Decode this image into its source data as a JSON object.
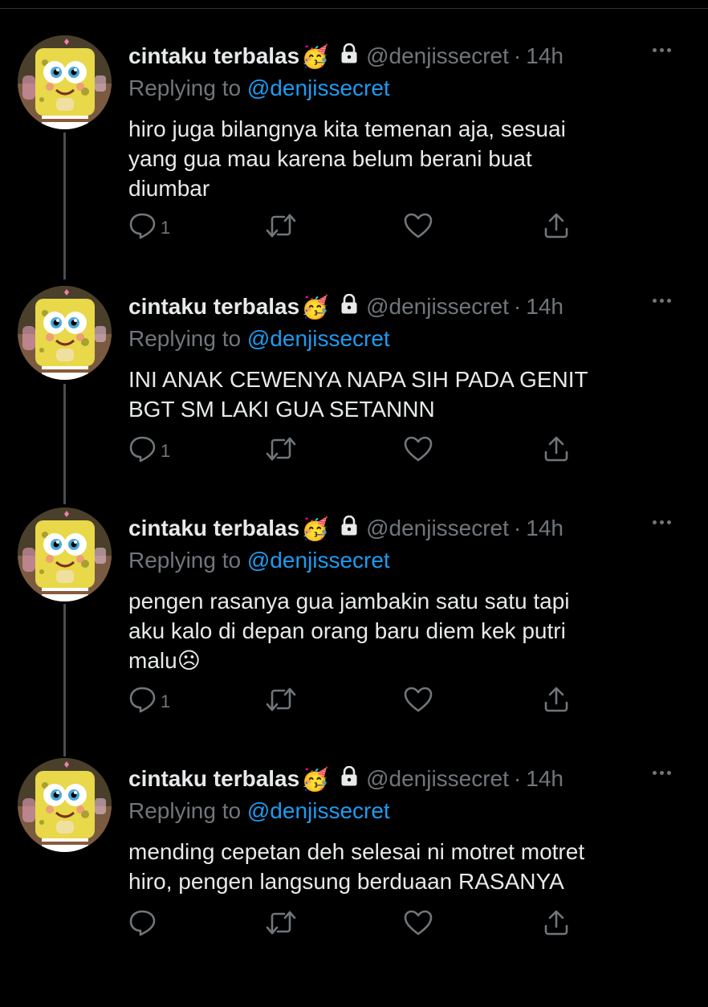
{
  "colors": {
    "background": "#000000",
    "text": "#e7e9ea",
    "muted": "#71767b",
    "link": "#1d9bf0"
  },
  "tweets": [
    {
      "name": "cintaku terbalas",
      "emoji": "🥳",
      "handle": "@denjissecret",
      "sep": "·",
      "time": "14h",
      "reply_prefix": "Replying to",
      "reply_to": "@denjissecret",
      "text": "hiro juga bilangnya kita temenan aja, sesuai\nyang gua mau karena belum berani buat\ndiumbar",
      "reply_count": "1"
    },
    {
      "name": "cintaku terbalas",
      "emoji": "🥳",
      "handle": "@denjissecret",
      "sep": "·",
      "time": "14h",
      "reply_prefix": "Replying to",
      "reply_to": "@denjissecret",
      "text": "INI ANAK CEWENYA NAPA SIH PADA GENIT\nBGT SM LAKI GUA SETANNN",
      "reply_count": "1"
    },
    {
      "name": "cintaku terbalas",
      "emoji": "🥳",
      "handle": "@denjissecret",
      "sep": "·",
      "time": "14h",
      "reply_prefix": "Replying to",
      "reply_to": "@denjissecret",
      "text": "pengen rasanya gua jambakin satu satu tapi\naku kalo di depan orang baru diem kek putri\nmalu☹",
      "reply_count": "1"
    },
    {
      "name": "cintaku terbalas",
      "emoji": "🥳",
      "handle": "@denjissecret",
      "sep": "·",
      "time": "14h",
      "reply_prefix": "Replying to",
      "reply_to": "@denjissecret",
      "text": "mending cepetan deh selesai ni motret motret\nhiro, pengen langsung berduaan RASANYA",
      "reply_count": ""
    }
  ]
}
